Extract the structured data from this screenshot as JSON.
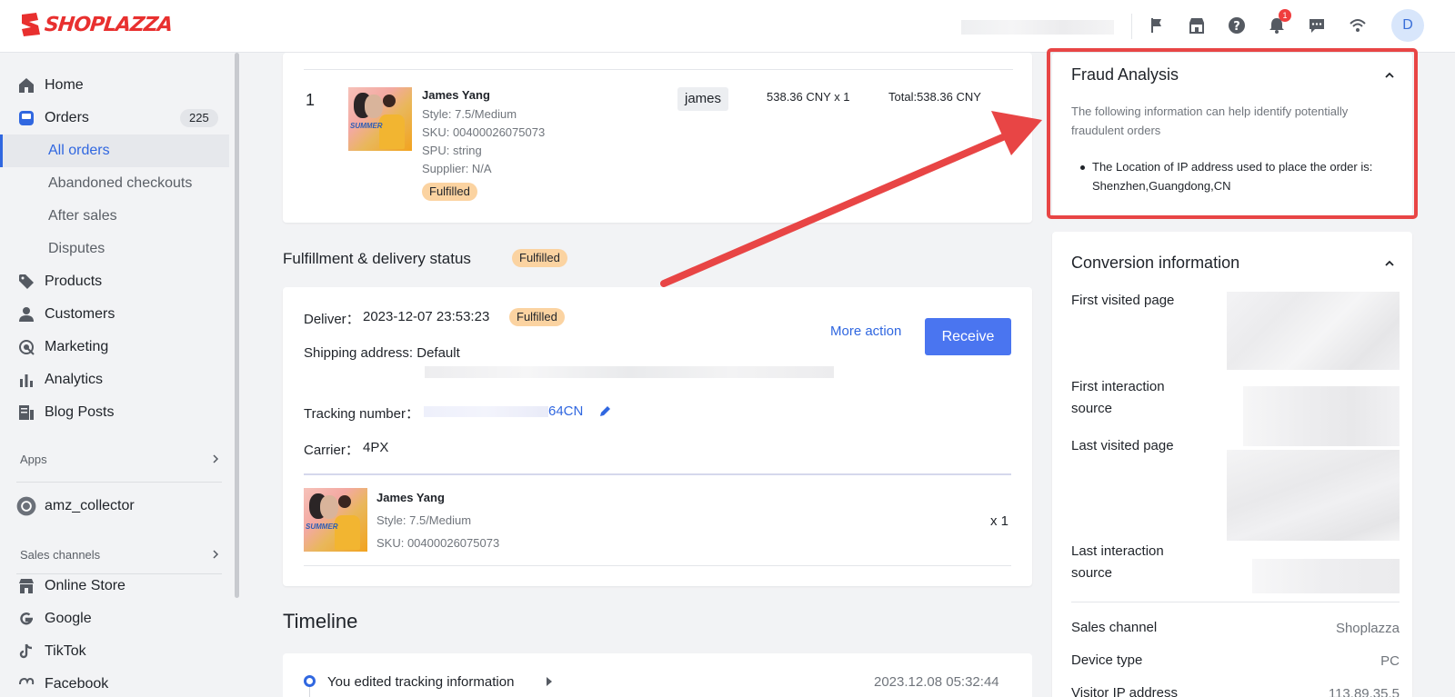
{
  "brand": {
    "name": "SHOPLAZZA",
    "color": "#e8302f"
  },
  "topbar": {
    "icons": [
      "flag-icon",
      "store-icon",
      "help-icon",
      "bell-icon",
      "chat-icon",
      "wifi-icon"
    ],
    "notification_count": "1",
    "avatar_initial": "D"
  },
  "sidebar": {
    "items": [
      {
        "label": "Home",
        "icon": "home-icon"
      },
      {
        "label": "Orders",
        "icon": "orders-icon",
        "count": "225"
      },
      {
        "label": "All orders"
      },
      {
        "label": "Abandoned checkouts"
      },
      {
        "label": "After sales"
      },
      {
        "label": "Disputes"
      },
      {
        "label": "Products",
        "icon": "tag-icon"
      },
      {
        "label": "Customers",
        "icon": "person-icon"
      },
      {
        "label": "Marketing",
        "icon": "marketing-icon"
      },
      {
        "label": "Analytics",
        "icon": "analytics-icon"
      },
      {
        "label": "Blog Posts",
        "icon": "blog-icon"
      }
    ],
    "apps_label": "Apps",
    "app_item": "amz_collector",
    "sales_channels_label": "Sales channels",
    "channels": [
      "Online Store",
      "Google",
      "TikTok",
      "Facebook"
    ]
  },
  "order_item": {
    "index": "1",
    "name": "James Yang",
    "style": "Style: 7.5/Medium",
    "sku": "SKU: 00400026075073",
    "spu": "SPU: string",
    "supplier": "Supplier: N/A",
    "status": "Fulfilled",
    "tag": "james",
    "price": "538.36 CNY x 1",
    "total": "Total:538.36 CNY"
  },
  "fulfillment": {
    "title": "Fulfillment & delivery status",
    "status": "Fulfilled",
    "deliver_label": "Deliver：",
    "deliver_time": "2023-12-07 23:53:23",
    "deliver_status": "Fulfilled",
    "shipping": "Shipping address: Default",
    "tracking_label": "Tracking number：",
    "tracking_suffix": "64CN",
    "carrier_label": "Carrier：",
    "carrier": "4PX",
    "more_action": "More action",
    "receive": "Receive",
    "item": {
      "name": "James Yang",
      "style": "Style: 7.5/Medium",
      "sku": "SKU: 00400026075073",
      "qty": "x 1"
    }
  },
  "timeline": {
    "title": "Timeline",
    "events": [
      {
        "text": "You edited tracking information",
        "time": "2023.12.08 05:32:44"
      }
    ]
  },
  "fraud": {
    "title": "Fraud Analysis",
    "description": "The following information can help identify potentially fraudulent orders",
    "bullet": "The Location of IP address used to place the order is: Shenzhen,Guangdong,CN",
    "highlight_color": "#e84545"
  },
  "conversion": {
    "title": "Conversion information",
    "first_visited": "First visited page",
    "first_interaction": "First interaction source",
    "last_visited": "Last visited page",
    "last_interaction": "Last interaction source",
    "rows": [
      {
        "label": "Sales channel",
        "value": "Shoplazza"
      },
      {
        "label": "Device type",
        "value": "PC"
      },
      {
        "label": "Visitor IP address",
        "value": "113.89.35.5"
      }
    ]
  }
}
